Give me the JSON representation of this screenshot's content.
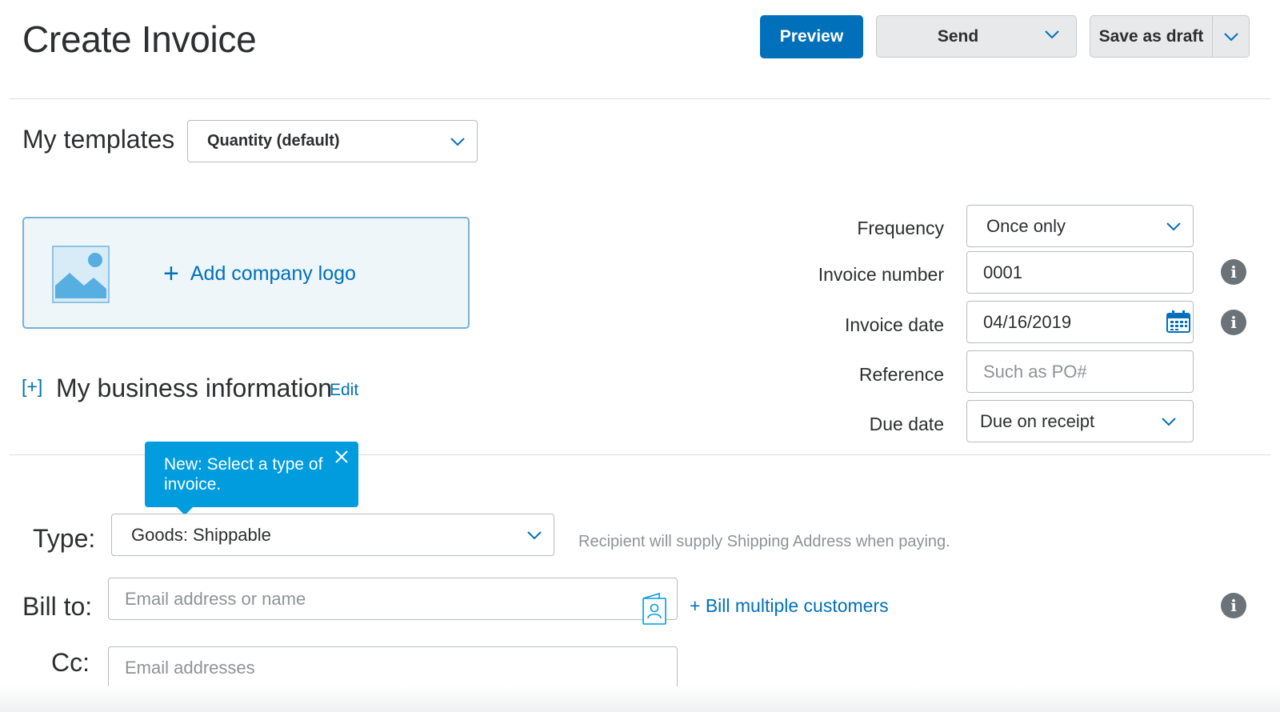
{
  "header": {
    "title": "Create Invoice",
    "preview_label": "Preview",
    "send_label": "Send",
    "save_draft_label": "Save as draft"
  },
  "templates": {
    "label": "My templates",
    "selected": "Quantity (default)"
  },
  "logo": {
    "add_label": "Add company logo"
  },
  "business": {
    "toggle": "[+]",
    "title": "My business information",
    "edit_label": "Edit"
  },
  "details": {
    "frequency_label": "Frequency",
    "frequency_value": "Once only",
    "invoice_number_label": "Invoice number",
    "invoice_number_value": "0001",
    "invoice_date_label": "Invoice date",
    "invoice_date_value": "04/16/2019",
    "reference_label": "Reference",
    "reference_placeholder": "Such as PO#",
    "due_date_label": "Due date",
    "due_date_value": "Due on receipt"
  },
  "tooltip": {
    "text": "New: Select a type of invoice."
  },
  "type": {
    "label": "Type:",
    "selected": "Goods: Shippable",
    "hint": "Recipient will supply Shipping Address when paying."
  },
  "bill_to": {
    "label": "Bill to:",
    "placeholder": "Email address or name",
    "multiple_label": "+ Bill multiple customers"
  },
  "cc": {
    "label": "Cc:",
    "placeholder": "Email addresses"
  },
  "colors": {
    "primary": "#0070ba",
    "tooltip": "#009cde",
    "logo_bg": "#eef6fa",
    "button_grey": "#e7e9ea",
    "info_icon": "#6c7378"
  }
}
